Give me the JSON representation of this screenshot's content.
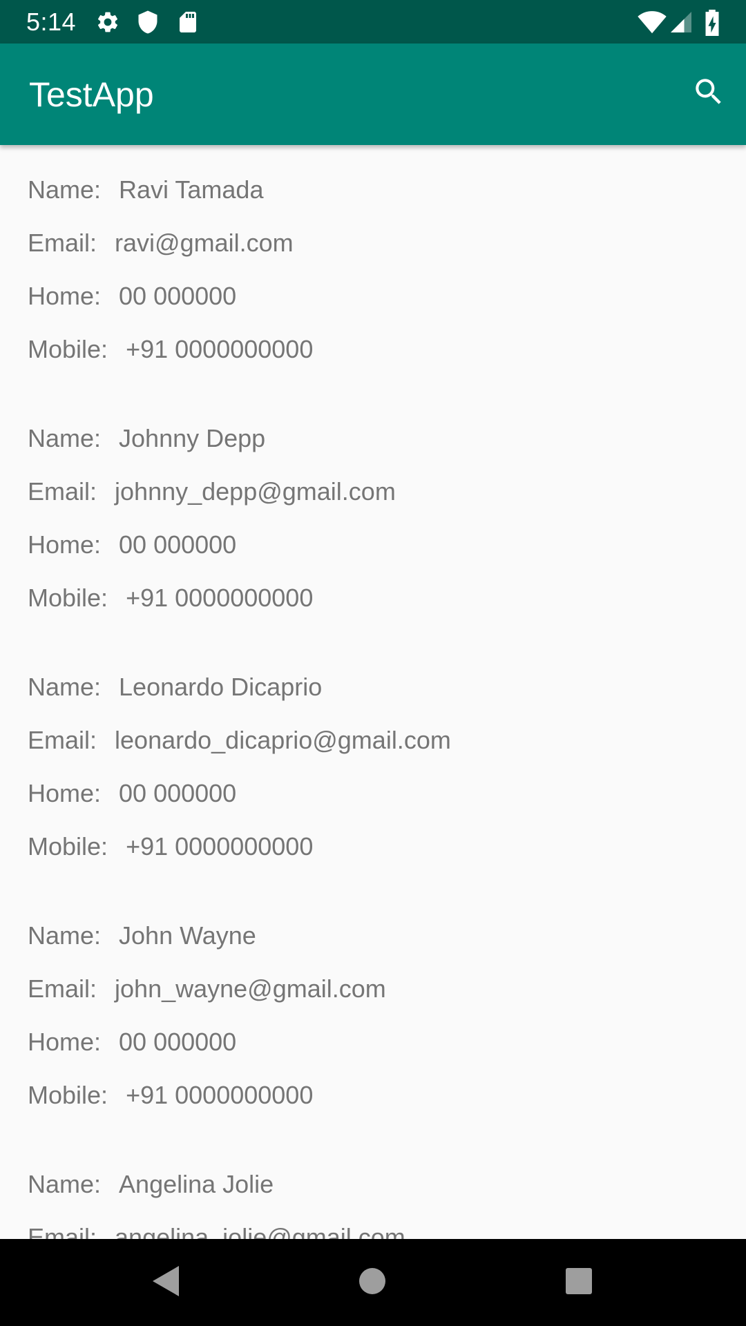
{
  "status_bar": {
    "time": "5:14",
    "icons": [
      "gear-icon",
      "shield-icon",
      "sd-card-icon",
      "wifi-icon",
      "cell-signal-icon",
      "battery-charging-icon"
    ]
  },
  "app_bar": {
    "title": "TestApp",
    "search_icon": "search-icon",
    "color": "#008577",
    "status_color": "#00574b"
  },
  "labels": {
    "name": "Name:",
    "email": "Email:",
    "home": "Home:",
    "mobile": "Mobile:"
  },
  "contacts": [
    {
      "name": "Ravi Tamada",
      "email": "ravi@gmail.com",
      "home": "00 000000",
      "mobile": "+91 0000000000"
    },
    {
      "name": "Johnny Depp",
      "email": "johnny_depp@gmail.com",
      "home": "00 000000",
      "mobile": "+91 0000000000"
    },
    {
      "name": "Leonardo Dicaprio",
      "email": "leonardo_dicaprio@gmail.com",
      "home": "00 000000",
      "mobile": "+91 0000000000"
    },
    {
      "name": "John Wayne",
      "email": "john_wayne@gmail.com",
      "home": "00 000000",
      "mobile": "+91 0000000000"
    },
    {
      "name": "Angelina Jolie",
      "email": "angelina_jolie@gmail.com",
      "home": "",
      "mobile": ""
    }
  ],
  "nav_bar": {
    "icons": [
      "back-icon",
      "home-icon",
      "recents-icon"
    ]
  }
}
